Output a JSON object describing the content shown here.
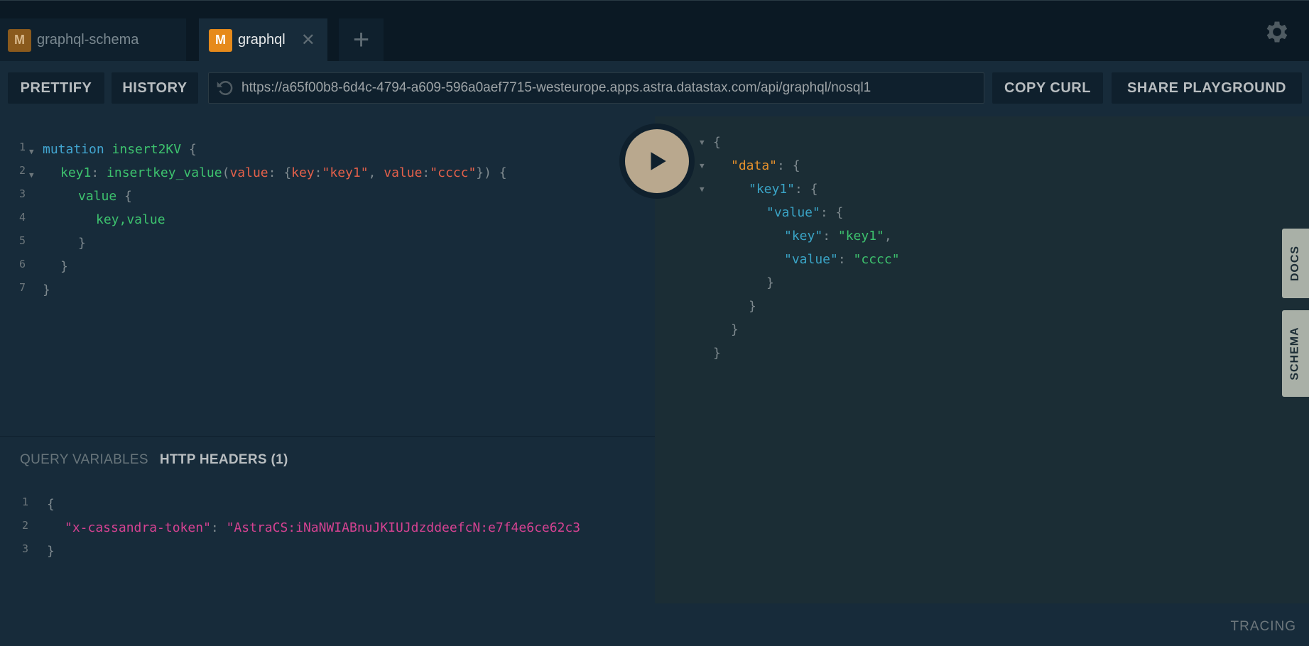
{
  "tabs": [
    {
      "badge": "M",
      "label": "graphql-schema",
      "active": false
    },
    {
      "badge": "M",
      "label": "graphql",
      "active": true,
      "close": "✕"
    }
  ],
  "add_tab": "+",
  "toolbar": {
    "prettify": "PRETTIFY",
    "history": "HISTORY",
    "url": "https://a65f00b8-6d4c-4794-a609-596a0aef7715-westeurope.apps.astra.datastax.com/api/graphql/nosql1",
    "copy_curl": "COPY CURL",
    "share": "SHARE PLAYGROUND"
  },
  "editor": {
    "line_numbers": [
      "1",
      "2",
      "3",
      "4",
      "5",
      "6",
      "7"
    ],
    "tokens": {
      "mutation": "mutation",
      "op_name": "insert2KV",
      "alias": "key1",
      "field": "insertkey_value",
      "arg_value": "value",
      "key_arg": "key",
      "key_val": "\"key1\"",
      "value_arg": "value",
      "value_val": "\"cccc\"",
      "sel_value": "value",
      "sel_fields": "key,value"
    }
  },
  "vars": {
    "tab_query_variables": "QUERY VARIABLES",
    "tab_http_headers": "HTTP HEADERS (1)",
    "line_numbers": [
      "1",
      "2",
      "3"
    ],
    "header_key": "\"x-cassandra-token\"",
    "header_value": "\"AstraCS:iNaNWIABnuJKIUJdzddeefcN:e7f4e6ce62c3"
  },
  "result": {
    "data_key": "\"data\"",
    "key1": "\"key1\"",
    "value_key": "\"value\"",
    "inner_key": "\"key\"",
    "inner_key_val": "\"key1\"",
    "inner_value": "\"value\"",
    "inner_value_val": "\"cccc\""
  },
  "side_tabs": {
    "docs": "DOCS",
    "schema": "SCHEMA"
  },
  "tracing": "TRACING",
  "colors": {
    "accent_badge": "#e68a1b",
    "run_button": "#b9a88e",
    "background": "#0f202d"
  }
}
